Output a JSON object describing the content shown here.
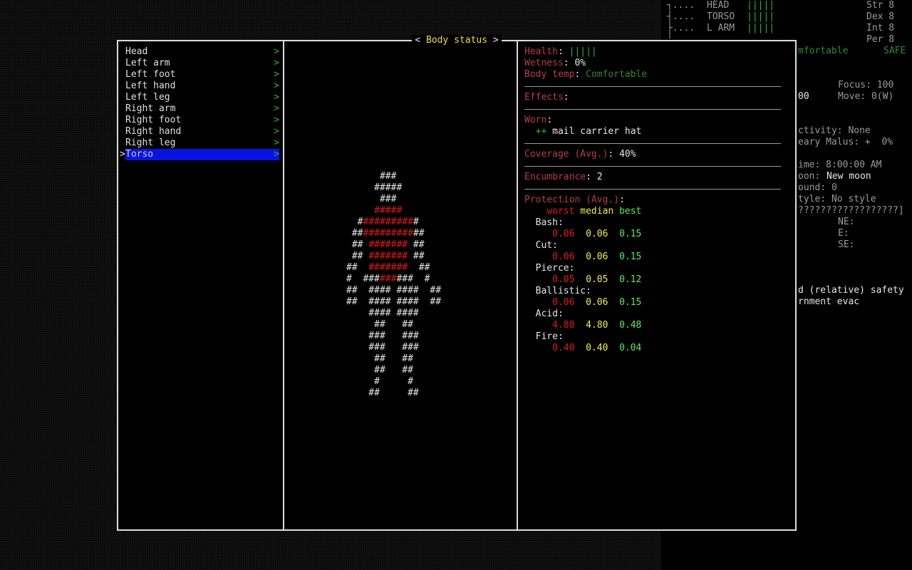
{
  "sidebar_top": {
    "tree_lines": [
      "┐....",
      "┤....",
      "└....",
      "│"
    ],
    "parts": [
      {
        "name": "HEAD",
        "bar": "|||||"
      },
      {
        "name": "TORSO",
        "bar": "|||||"
      },
      {
        "name": "L ARM",
        "bar": "|||||"
      }
    ],
    "stats": [
      "Str 8",
      "Dex 8",
      "Int 8",
      "Per 8"
    ],
    "mid_texts": [
      "mfortable",
      "SAFE"
    ],
    "focus": "Focus: 100",
    "move": "Move: 0(W)",
    "left00": "00",
    "activity": "ctivity: None",
    "malus": "eary Malus: +  0%",
    "time": "ime: 8:00:00 AM",
    "moon_label": "oon: ",
    "moon_val": "New moon",
    "sound": "ound: 0",
    "style": "tyle: No style",
    "qmarks": "??????????????????]",
    "ne": "NE:",
    "e": "E:",
    "se": "SE:",
    "safety": "d (relative) safety",
    "evac": "rnment evac"
  },
  "dialog": {
    "title": "Body status",
    "left_bracket": "<",
    "right_bracket": ">",
    "parts": [
      {
        "label": "Head",
        "chev": ">"
      },
      {
        "label": "Left arm",
        "chev": ">"
      },
      {
        "label": "Left foot",
        "chev": ">"
      },
      {
        "label": "Left hand",
        "chev": ">"
      },
      {
        "label": "Left leg",
        "chev": ">"
      },
      {
        "label": "Right arm",
        "chev": ">"
      },
      {
        "label": "Right foot",
        "chev": ">"
      },
      {
        "label": "Right hand",
        "chev": ">"
      },
      {
        "label": "Right leg",
        "chev": ">"
      },
      {
        "label": "Torso",
        "chev": ">",
        "selected": true
      }
    ],
    "select_marker": ">",
    "figure_rows": [
      [
        [
          "      ###",
          "w"
        ]
      ],
      [
        [
          "     #####",
          "w"
        ]
      ],
      [
        [
          "      ###",
          "w"
        ]
      ],
      [
        [
          "     ",
          "w"
        ],
        [
          "#####",
          "r"
        ]
      ],
      [
        [
          "  #",
          "w"
        ],
        [
          "#########",
          "r"
        ],
        [
          "#",
          "w"
        ]
      ],
      [
        [
          " ##",
          "w"
        ],
        [
          "#########",
          "r"
        ],
        [
          "##",
          "w"
        ]
      ],
      [
        [
          " ## ",
          "w"
        ],
        [
          "#######",
          "r"
        ],
        [
          " ##",
          "w"
        ]
      ],
      [
        [
          " ## ",
          "w"
        ],
        [
          "#######",
          "r"
        ],
        [
          " ##",
          "w"
        ]
      ],
      [
        [
          "##  ",
          "w"
        ],
        [
          "#######",
          "r"
        ],
        [
          "  ##",
          "w"
        ]
      ],
      [
        [
          "#  ###",
          "w"
        ],
        [
          "###",
          "r"
        ],
        [
          "###  #",
          "w"
        ]
      ],
      [
        [
          "##  #### ####  ##",
          "w"
        ]
      ],
      [
        [
          "##  #### ####  ##",
          "w"
        ]
      ],
      [
        [
          "    #### ####",
          "w"
        ]
      ],
      [
        [
          "     ##   ##",
          "w"
        ]
      ],
      [
        [
          "    ###   ###",
          "w"
        ]
      ],
      [
        [
          "    ###   ###",
          "w"
        ]
      ],
      [
        [
          "     ##   ##",
          "w"
        ]
      ],
      [
        [
          "     ##   ##",
          "w"
        ]
      ],
      [
        [
          "     #     #",
          "w"
        ]
      ],
      [
        [
          "    ##     ##",
          "w"
        ]
      ]
    ],
    "info": {
      "health_label": "Health",
      "health_bar": "|||||",
      "wetness_label": "Wetness",
      "wetness_val": "0%",
      "bodytemp_label": "Body temp",
      "bodytemp_val": "Comfortable",
      "effects_label": "Effects",
      "worn_label": "Worn",
      "worn_mark": "++",
      "worn_item": "mail carrier hat",
      "coverage_label": "Coverage (Avg.)",
      "coverage_val": "40%",
      "encumbrance_label": "Encumbrance",
      "encumbrance_val": "2",
      "protection_label": "Protection (Avg.)",
      "col_worst": "worst",
      "col_median": "median",
      "col_best": "best",
      "protection": [
        {
          "type": "Bash:",
          "worst": "0.06",
          "median": "0.06",
          "best": "0.15"
        },
        {
          "type": "Cut:",
          "worst": "0.06",
          "median": "0.06",
          "best": "0.15"
        },
        {
          "type": "Pierce:",
          "worst": "0.05",
          "median": "0.05",
          "best": "0.12"
        },
        {
          "type": "Ballistic:",
          "worst": "0.06",
          "median": "0.06",
          "best": "0.15"
        },
        {
          "type": "Acid:",
          "worst": "4.80",
          "median": "4.80",
          "best": "0.48"
        },
        {
          "type": "Fire:",
          "worst": "0.40",
          "median": "0.40",
          "best": "0.04"
        }
      ]
    }
  }
}
